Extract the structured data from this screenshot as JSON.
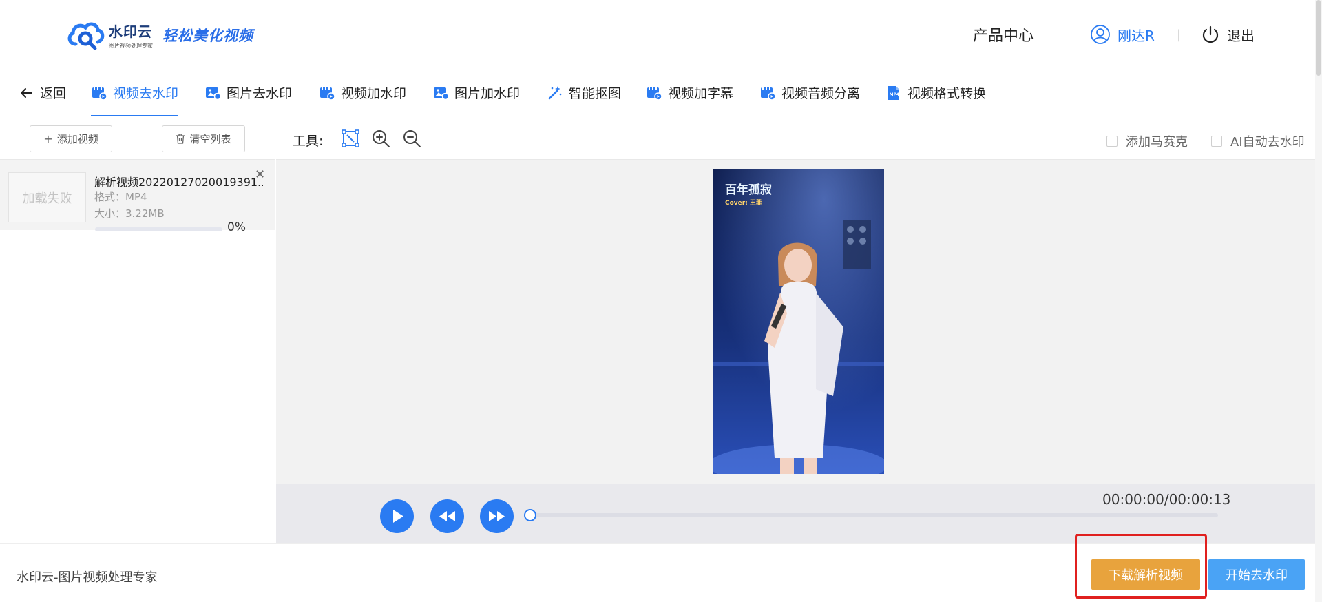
{
  "header": {
    "logo_name": "水印云",
    "logo_tagline": "图片视频处理专家",
    "logo_slogan": "轻松美化视频",
    "product_center": "产品中心",
    "username": "刚达R",
    "divider": "|",
    "logout": "退出"
  },
  "tabs": [
    {
      "label": "返回",
      "icon": "back-arrow-icon"
    },
    {
      "label": "视频去水印",
      "icon": "video-icon",
      "active": true
    },
    {
      "label": "图片去水印",
      "icon": "image-icon"
    },
    {
      "label": "视频加水印",
      "icon": "video-icon"
    },
    {
      "label": "图片加水印",
      "icon": "image-icon"
    },
    {
      "label": "智能抠图",
      "icon": "magic-wand-icon"
    },
    {
      "label": "视频加字幕",
      "icon": "video-icon"
    },
    {
      "label": "视频音频分离",
      "icon": "video-icon"
    },
    {
      "label": "视频格式转换",
      "icon": "mp4-file-icon"
    }
  ],
  "left_panel": {
    "add_video": "添加视频",
    "clear_list": "清空列表",
    "file": {
      "thumb_status": "加载失败",
      "name": "解析视频20220127020019391...",
      "format": "格式：MP4",
      "size": "大小：3.22MB",
      "progress_text": "0%",
      "progress": 0
    }
  },
  "tools": {
    "label": "工具:",
    "mosaic": "添加马赛克",
    "ai_remove": "AI自动去水印"
  },
  "video": {
    "overlay_title": "百年孤寂",
    "overlay_cover": "Cover: 王菲"
  },
  "player": {
    "time": "00:00:00/00:00:13",
    "progress": 0
  },
  "footer": {
    "text": "水印云-图片视频处理专家",
    "download_button": "下载解析视频",
    "start_button": "开始去水印"
  },
  "colors": {
    "accent": "#2a7bf2",
    "download": "#e8a33d",
    "start": "#4aa3f5",
    "highlight": "#e0201f"
  }
}
